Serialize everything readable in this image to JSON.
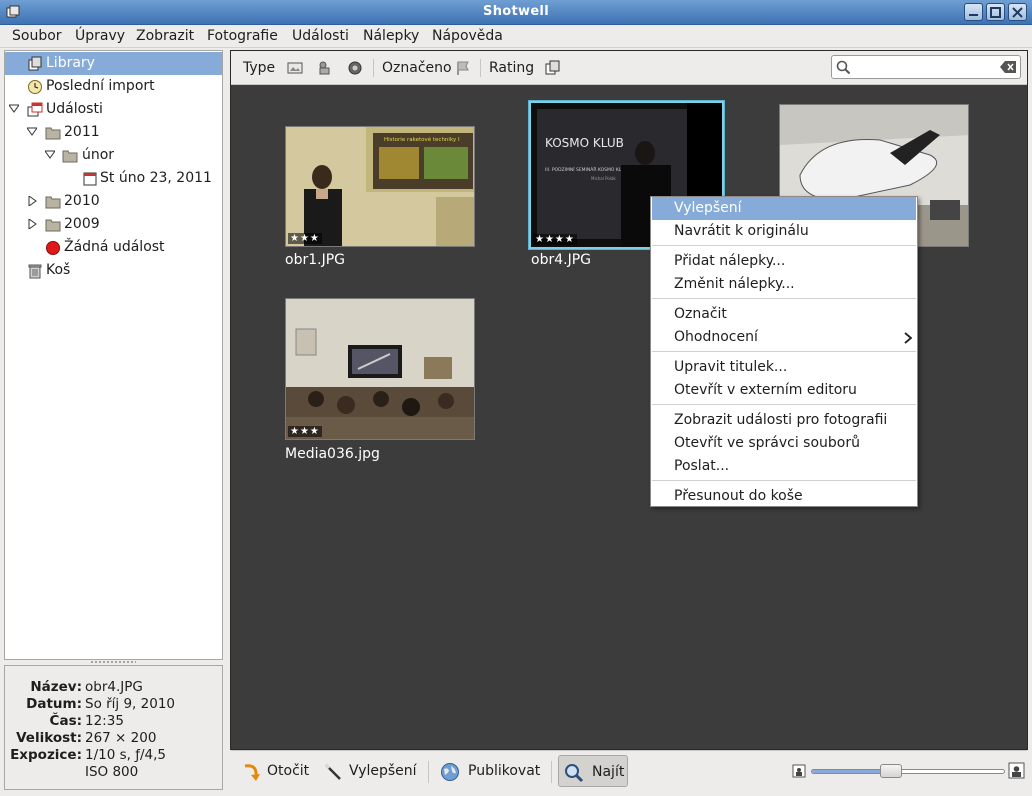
{
  "window": {
    "title": "Shotwell"
  },
  "colors": {
    "selection": "#86abd9",
    "viewer_bg": "#3c3c3c",
    "titlebar": "#4a80c0"
  },
  "menubar": [
    {
      "label": "Soubor",
      "ul": "S"
    },
    {
      "label": "Úpravy",
      "ul": "Ú"
    },
    {
      "label": "Zobrazit",
      "ul": "Z"
    },
    {
      "label": "Fotografie",
      "ul": "F"
    },
    {
      "label": "Události",
      "ul": ""
    },
    {
      "label": "Nálepky",
      "ul": "N"
    },
    {
      "label": "Nápověda",
      "ul": "N"
    }
  ],
  "sidebar": {
    "library": "Library",
    "last_import": "Poslední import",
    "events": "Události",
    "y2011": "2011",
    "month_unor": "únor",
    "event_day": "St úno 23, 2011",
    "y2010": "2010",
    "y2009": "2009",
    "no_event": "Žádná událost",
    "trash": "Koš"
  },
  "info": {
    "name_k": "Název:",
    "name_v": "obr4.JPG",
    "date_k": "Datum:",
    "date_v": "So říj 9, 2010",
    "time_k": "Čas:",
    "time_v": "12:35",
    "size_k": "Velikost:",
    "size_v": "267 × 200",
    "exposure_k": "Expozice:",
    "exposure_v1": "1/10 s, ƒ/4,5",
    "exposure_v2": "ISO 800"
  },
  "toolbar": {
    "type_label": "Type",
    "flagged_label": "Označeno",
    "rating_label": "Rating",
    "search_placeholder": ""
  },
  "photos": [
    {
      "caption": "obr1.JPG",
      "rating": 3,
      "stars": "★★★"
    },
    {
      "caption": "obr4.JPG",
      "rating": 4,
      "stars": "★★★★"
    },
    {
      "caption": "",
      "rating": 0,
      "stars": ""
    },
    {
      "caption": "Media036.jpg",
      "rating": 3,
      "stars": "★★★"
    }
  ],
  "photo_texts": {
    "slide1_title": "Historie raketové techniky I",
    "slide2_title": "KOSMO KLUB",
    "slide2_sub": "III. PODZIMNÍ SEMINÁŘ KOSMO KLUBU",
    "slide2_author": "Michal Polák"
  },
  "context_menu": {
    "items": [
      "Vylepšení",
      "Navrátit k originálu",
      "Přidat nálepky...",
      "Změnit nálepky...",
      "Označit",
      "Ohodnocení",
      "Upravit titulek...",
      "Otevřít v externím editoru",
      "Zobrazit události pro fotografii",
      "Otevřít ve správci souborů",
      "Poslat...",
      "Přesunout do koše"
    ]
  },
  "bottombar": {
    "rotate": "Otočit",
    "enhance": "Vylepšení",
    "publish": "Publikovat",
    "find": "Najít",
    "zoom_fraction": 0.4
  }
}
